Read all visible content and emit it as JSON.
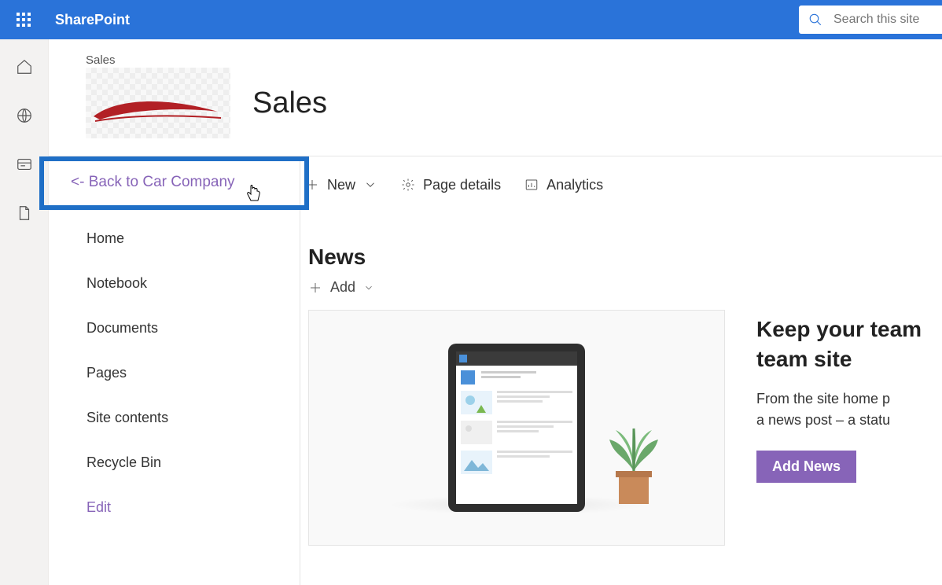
{
  "header": {
    "brand": "SharePoint",
    "search_placeholder": "Search this site"
  },
  "site": {
    "breadcrumb": "Sales",
    "title": "Sales",
    "back_link": "<- Back to Car Company"
  },
  "sidenav": {
    "items": [
      {
        "label": "Home"
      },
      {
        "label": "Notebook"
      },
      {
        "label": "Documents"
      },
      {
        "label": "Pages"
      },
      {
        "label": "Site contents"
      },
      {
        "label": "Recycle Bin"
      }
    ],
    "edit": "Edit"
  },
  "commandbar": {
    "new": "New",
    "page_details": "Page details",
    "analytics": "Analytics"
  },
  "news": {
    "title": "News",
    "add": "Add",
    "side_heading_line1": "Keep your team",
    "side_heading_line2": "team site",
    "side_body_line1": "From the site home p",
    "side_body_line2": "a news post – a statu",
    "add_news_button": "Add News"
  }
}
